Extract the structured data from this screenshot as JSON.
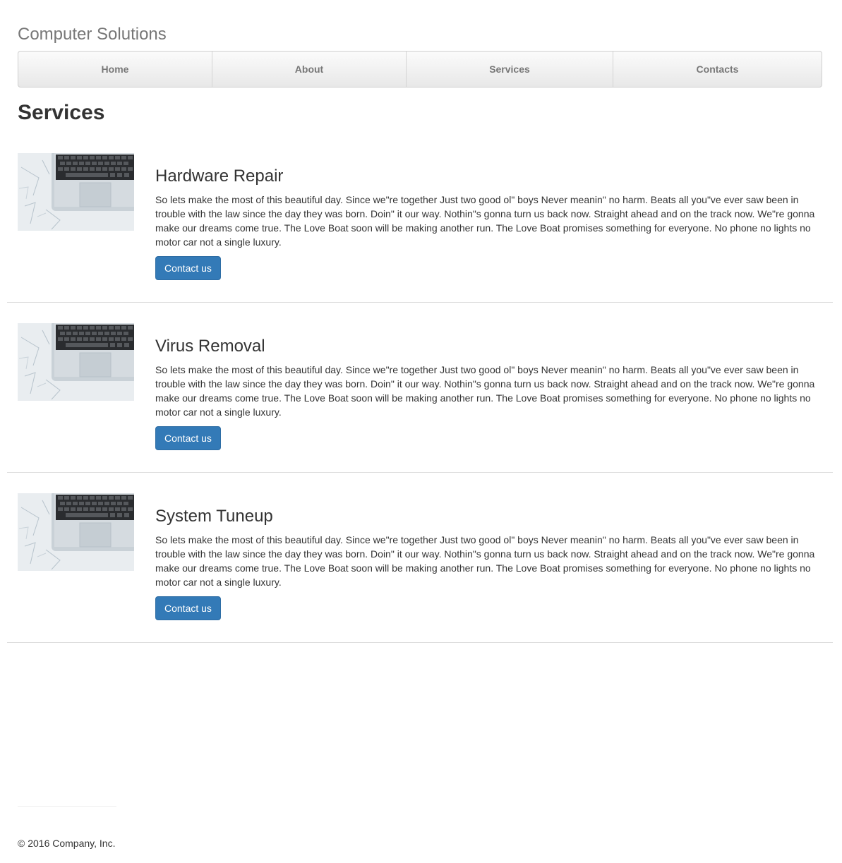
{
  "brand": "Computer Solutions",
  "nav": [
    {
      "label": "Home"
    },
    {
      "label": "About"
    },
    {
      "label": "Services"
    },
    {
      "label": "Contacts"
    }
  ],
  "page_title": "Services",
  "services": [
    {
      "title": "Hardware Repair",
      "image": "laptop-keyboard-photo",
      "description": "So lets make the most of this beautiful day. Since we\"re together Just two good ol\" boys Never meanin\" no harm. Beats all you\"ve ever saw been in trouble with the law since the day they was born. Doin\" it our way. Nothin\"s gonna turn us back now. Straight ahead and on the track now. We\"re gonna make our dreams come true. The Love Boat soon will be making another run. The Love Boat promises something for everyone. No phone no lights no motor car not a single luxury.",
      "button": "Contact us"
    },
    {
      "title": "Virus Removal",
      "image": "laptop-keyboard-photo",
      "description": "So lets make the most of this beautiful day. Since we\"re together Just two good ol\" boys Never meanin\" no harm. Beats all you\"ve ever saw been in trouble with the law since the day they was born. Doin\" it our way. Nothin\"s gonna turn us back now. Straight ahead and on the track now. We\"re gonna make our dreams come true. The Love Boat soon will be making another run. The Love Boat promises something for everyone. No phone no lights no motor car not a single luxury.",
      "button": "Contact us"
    },
    {
      "title": "System Tuneup",
      "image": "laptop-keyboard-photo",
      "description": "So lets make the most of this beautiful day. Since we\"re together Just two good ol\" boys Never meanin\" no harm. Beats all you\"ve ever saw been in trouble with the law since the day they was born. Doin\" it our way. Nothin\"s gonna turn us back now. Straight ahead and on the track now. We\"re gonna make our dreams come true. The Love Boat soon will be making another run. The Love Boat promises something for everyone. No phone no lights no motor car not a single luxury.",
      "button": "Contact us"
    }
  ],
  "footer": "© 2016 Company, Inc.",
  "colors": {
    "primary_button": "#337ab7",
    "brand_text": "#777777",
    "body_text": "#333333"
  }
}
